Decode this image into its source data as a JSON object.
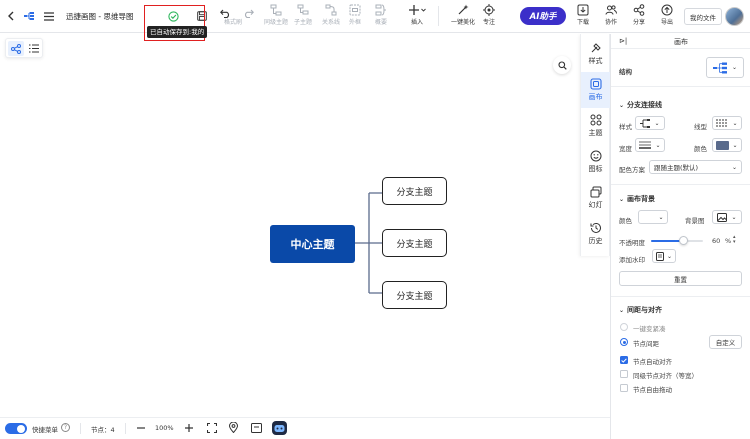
{
  "app": {
    "title": "迅捷画图 - 思维导图",
    "autosave_tip": "已自动保存到:我的"
  },
  "toolbar": {
    "items": [
      {
        "label": "格式刷"
      },
      {
        "label": "同级主题"
      },
      {
        "label": "子主题"
      },
      {
        "label": "关系线"
      },
      {
        "label": "外框"
      },
      {
        "label": "概要"
      },
      {
        "label": "插入"
      },
      {
        "label": "一键美化"
      },
      {
        "label": "专注"
      }
    ],
    "ai_label": "AI助手",
    "download": "下载",
    "collab": "协作",
    "share": "分享",
    "export": "导出",
    "my_files": "我的文件"
  },
  "mindmap": {
    "center": "中心主题",
    "branches": [
      "分支主题",
      "分支主题",
      "分支主题"
    ]
  },
  "tabs": [
    {
      "label": "样式",
      "icon": "brush-icon"
    },
    {
      "label": "画布",
      "icon": "canvas-icon"
    },
    {
      "label": "主题",
      "icon": "theme-icon"
    },
    {
      "label": "图标",
      "icon": "smile-icon"
    },
    {
      "label": "幻灯",
      "icon": "slides-icon"
    },
    {
      "label": "历史",
      "icon": "history-icon"
    }
  ],
  "panel": {
    "title": "画布",
    "structure_label": "结构",
    "branch_section": "分支连接线",
    "style_label": "样式",
    "linetype_label": "线型",
    "width_label": "宽度",
    "color_label": "颜色",
    "scheme_label": "配色方案",
    "scheme_value": "跟随主题(默认)",
    "canvas_bg_section": "画布背景",
    "bg_color_label": "颜色",
    "bg_image_label": "背景图",
    "opacity_label": "不透明度",
    "opacity_value": "60",
    "opacity_unit": "%",
    "watermark_label": "添加水印",
    "reset_label": "重置",
    "spacing_section": "间距与对齐",
    "opt_compact": "一键变紧凑",
    "opt_spacing": "节点间距",
    "custom_label": "自定义",
    "chk_auto_align": "节点自动对齐",
    "chk_same_level": "同级节点对齐（等宽）",
    "chk_free_drag": "节点自由拖动"
  },
  "bottom": {
    "quick_menu": "快捷菜单",
    "node_count": "节点：4",
    "zoom": "100%"
  },
  "colors": {
    "accent": "#2b6ce6",
    "center_fill": "#0a49a8",
    "ai_bg": "#3b2fc9",
    "tip_border": "#e02020",
    "line_color": "#5a6b8c"
  }
}
